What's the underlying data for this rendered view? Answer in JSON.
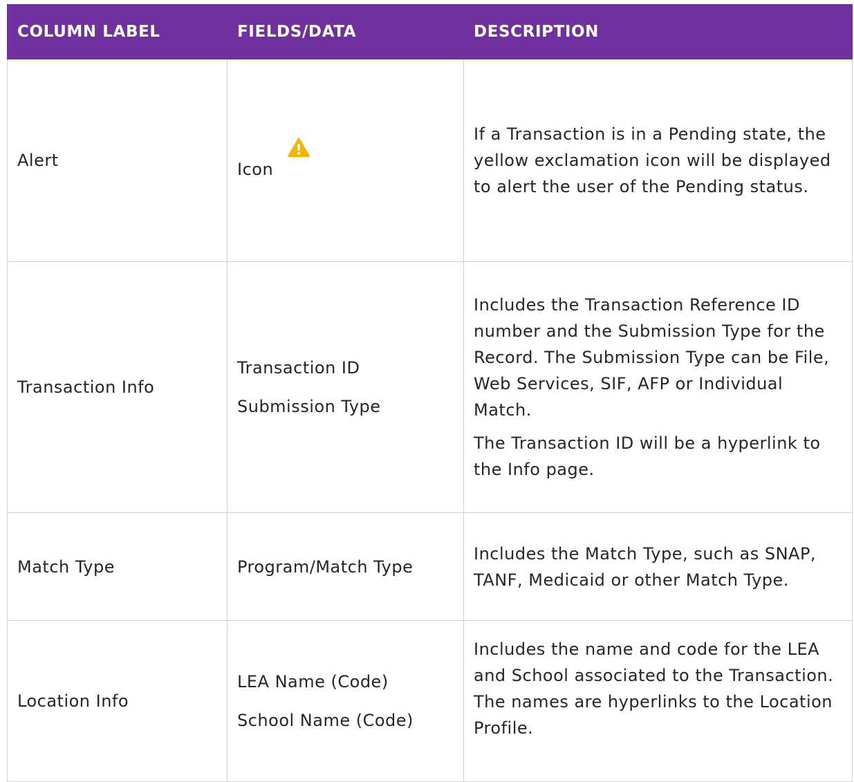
{
  "header": {
    "col1": "COLUMN LABEL",
    "col2": "FIELDS/DATA",
    "col3": "DESCRIPTION"
  },
  "rows": [
    {
      "label": "Alert",
      "fields": [
        "Icon"
      ],
      "icon": "warning-icon",
      "description": [
        "If a Transaction is in a Pending state, the yellow exclamation icon will be displayed to alert the user of the Pending status."
      ]
    },
    {
      "label": "Transaction Info",
      "fields": [
        "Transaction ID",
        "Submission Type"
      ],
      "description": [
        "Includes the Transaction Reference ID number and the Submission Type for the Record. The Submission Type can be File, Web Services, SIF, AFP or Individual Match.",
        "The Transaction ID will be a hyperlink to the Info page."
      ]
    },
    {
      "label": "Match Type",
      "fields": [
        "Program/Match Type"
      ],
      "description": [
        "Includes the Match Type, such as SNAP, TANF, Medicaid or other Match Type."
      ]
    },
    {
      "label": "Location Info",
      "fields": [
        "LEA Name (Code)",
        "School Name (Code)"
      ],
      "description": [
        "Includes the name and code for the LEA and School associated to the Transaction. The names are hyperlinks to the Location Profile."
      ]
    }
  ],
  "colors": {
    "header_bg": "#7030a0",
    "header_text": "#ffffff",
    "warning_icon": "#f5b400"
  }
}
